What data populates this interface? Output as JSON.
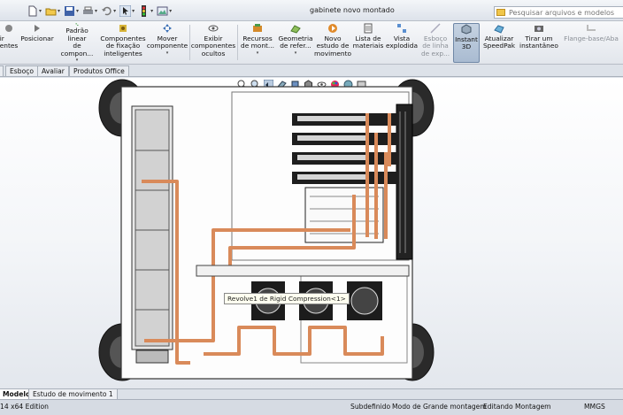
{
  "window": {
    "title": "gabinete novo montado"
  },
  "search": {
    "placeholder": "Pesquisar arquivos e modelos"
  },
  "quick_access": [
    {
      "icon": "new-document-icon"
    },
    {
      "icon": "open-folder-icon"
    },
    {
      "icon": "save-icon"
    },
    {
      "icon": "print-icon"
    },
    {
      "icon": "undo-icon"
    },
    {
      "icon": "select-pointer-icon"
    },
    {
      "icon": "traffic-light-icon"
    },
    {
      "icon": "file-properties-icon"
    },
    {
      "icon": "options-icon"
    }
  ],
  "command_manager": {
    "buttons": [
      {
        "label": "ir\nentes",
        "icon": "mate-icon"
      },
      {
        "label": "Posicionar",
        "icon": "move-component-icon"
      },
      {
        "label": "Padrão linear\nde compon...",
        "icon": "linear-pattern-icon"
      },
      {
        "label": "Componentes\nde fixação\ninteligentes",
        "icon": "smart-fasteners-icon"
      },
      {
        "label": "Mover\ncomponente",
        "icon": "move-icon"
      },
      {
        "label": "Exibir\ncomponentes\nocultos",
        "icon": "show-hidden-icon"
      },
      {
        "label": "Recursos\nde mont...",
        "icon": "assembly-features-icon"
      },
      {
        "label": "Geometria\nde refer...",
        "icon": "reference-geometry-icon"
      },
      {
        "label": "Novo\nestudo de\nmovimento",
        "icon": "motion-study-icon"
      },
      {
        "label": "Lista de\nmateriais",
        "icon": "bill-of-materials-icon"
      },
      {
        "label": "Vista\nexplodida",
        "icon": "exploded-view-icon"
      },
      {
        "label": "Esboço\nde linha\nde exp...",
        "icon": "explode-line-sketch-icon"
      },
      {
        "label": "Instant\n3D",
        "icon": "instant3d-icon"
      },
      {
        "label": "Atualizar\nSpeedPak",
        "icon": "speedpak-icon"
      },
      {
        "label": "Tirar um\ninstantâneo",
        "icon": "snapshot-icon"
      },
      {
        "label": "Flange-base/Aba",
        "icon": "base-flange-icon"
      }
    ]
  },
  "tabs": [
    "Esboço",
    "Avaliar",
    "Produtos Office"
  ],
  "viewport": {
    "tooltip": "Revolve1 de Rigid Compression<1>",
    "heads_up": [
      "zoom-to-fit-icon",
      "zoom-area-icon",
      "previous-view-icon",
      "section-view-icon",
      "view-orientation-icon",
      "display-style-icon",
      "hide-show-icon",
      "edit-appearance-icon",
      "scene-icon",
      "view-settings-icon"
    ]
  },
  "bottom_tabs": [
    "Modelo",
    "Estudo de movimento 1"
  ],
  "status_bar": {
    "edition": "14 x64 Edition",
    "state": "Subdefinido",
    "mode": "Modo de Grande montagem",
    "editing": "Editando Montagem",
    "units": "MMGS"
  },
  "colors": {
    "copper": "#d98a5a",
    "accent": "#3b6aa0"
  }
}
